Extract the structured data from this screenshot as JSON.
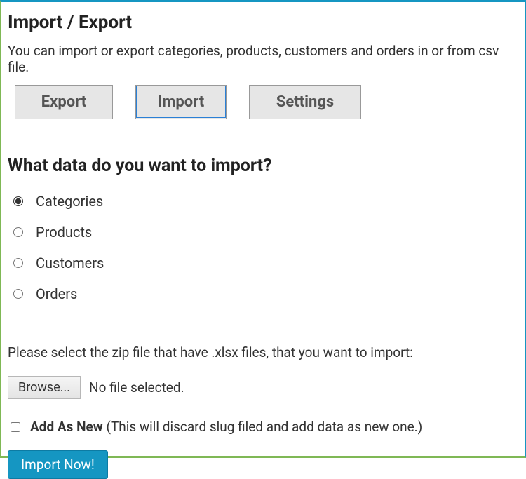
{
  "header": {
    "title": "Import / Export",
    "intro": "You can import or export categories, products, customers and orders in or from csv file."
  },
  "tabs": {
    "export": "Export",
    "import": "Import",
    "settings": "Settings"
  },
  "section": {
    "heading": "What data do you want to import?"
  },
  "dataTypes": {
    "categories": "Categories",
    "products": "Products",
    "customers": "Customers",
    "orders": "Orders"
  },
  "file": {
    "instruction": "Please select the zip file that have .xlsx files, that you want to import:",
    "browse": "Browse...",
    "status": "No file selected."
  },
  "addNew": {
    "label": "Add As New",
    "desc": " (This will discard slug filed and add data as new one.)"
  },
  "actions": {
    "importNow": "Import Now!"
  }
}
